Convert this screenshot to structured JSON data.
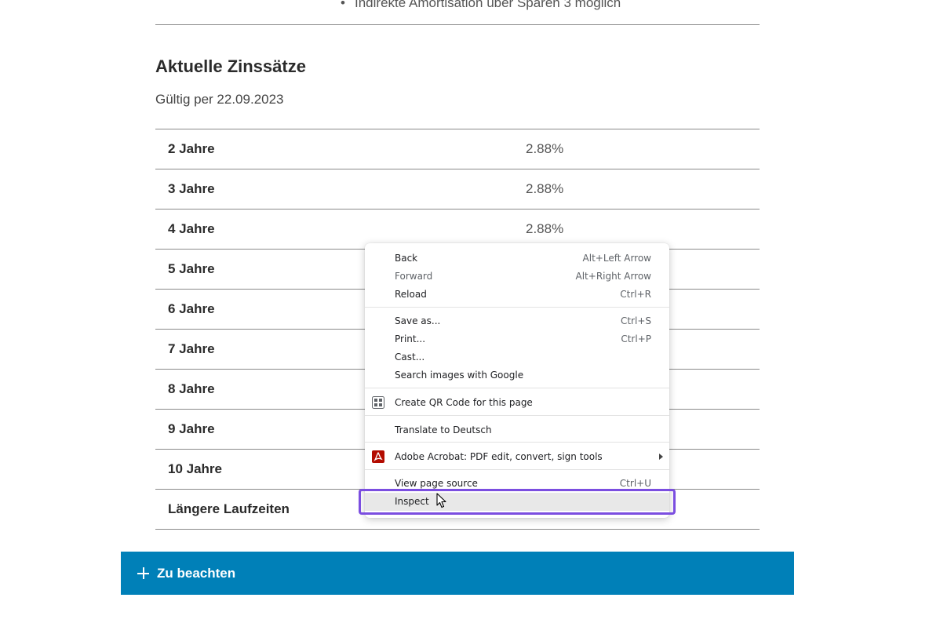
{
  "page": {
    "bullet_text": "Indirekte Amortisation über Sparen 3 möglich",
    "section_title": "Aktuelle Zinssätze",
    "valid_text": "Gültig per 22.09.2023",
    "rates": [
      {
        "term": "2 Jahre",
        "rate": "2.88%"
      },
      {
        "term": "3 Jahre",
        "rate": "2.88%"
      },
      {
        "term": "4 Jahre",
        "rate": "2.88%"
      },
      {
        "term": "5 Jahre",
        "rate": ""
      },
      {
        "term": "6 Jahre",
        "rate": ""
      },
      {
        "term": "7 Jahre",
        "rate": ""
      },
      {
        "term": "8 Jahre",
        "rate": ""
      },
      {
        "term": "9 Jahre",
        "rate": ""
      },
      {
        "term": "10 Jahre",
        "rate": ""
      },
      {
        "term": "Längere Laufzeiten",
        "rate": ""
      }
    ],
    "accordion_label": "Zu beachten",
    "accent_color": "#0080b8"
  },
  "context_menu": {
    "items": [
      {
        "label": "Back",
        "shortcut": "Alt+Left Arrow"
      },
      {
        "label": "Forward",
        "shortcut": "Alt+Right Arrow"
      },
      {
        "label": "Reload",
        "shortcut": "Ctrl+R"
      },
      {
        "label": "Save as...",
        "shortcut": "Ctrl+S"
      },
      {
        "label": "Print...",
        "shortcut": "Ctrl+P"
      },
      {
        "label": "Cast...",
        "shortcut": ""
      },
      {
        "label": "Search images with Google",
        "shortcut": ""
      },
      {
        "label": "Create QR Code for this page",
        "shortcut": "",
        "icon": "qr-code-icon"
      },
      {
        "label": "Translate to Deutsch",
        "shortcut": ""
      },
      {
        "label": "Adobe Acrobat: PDF edit, convert, sign tools",
        "shortcut": "",
        "icon": "adobe-acrobat-icon"
      },
      {
        "label": "View page source",
        "shortcut": "Ctrl+U"
      },
      {
        "label": "Inspect",
        "shortcut": ""
      }
    ],
    "highlight_color": "#7b4ee0"
  }
}
